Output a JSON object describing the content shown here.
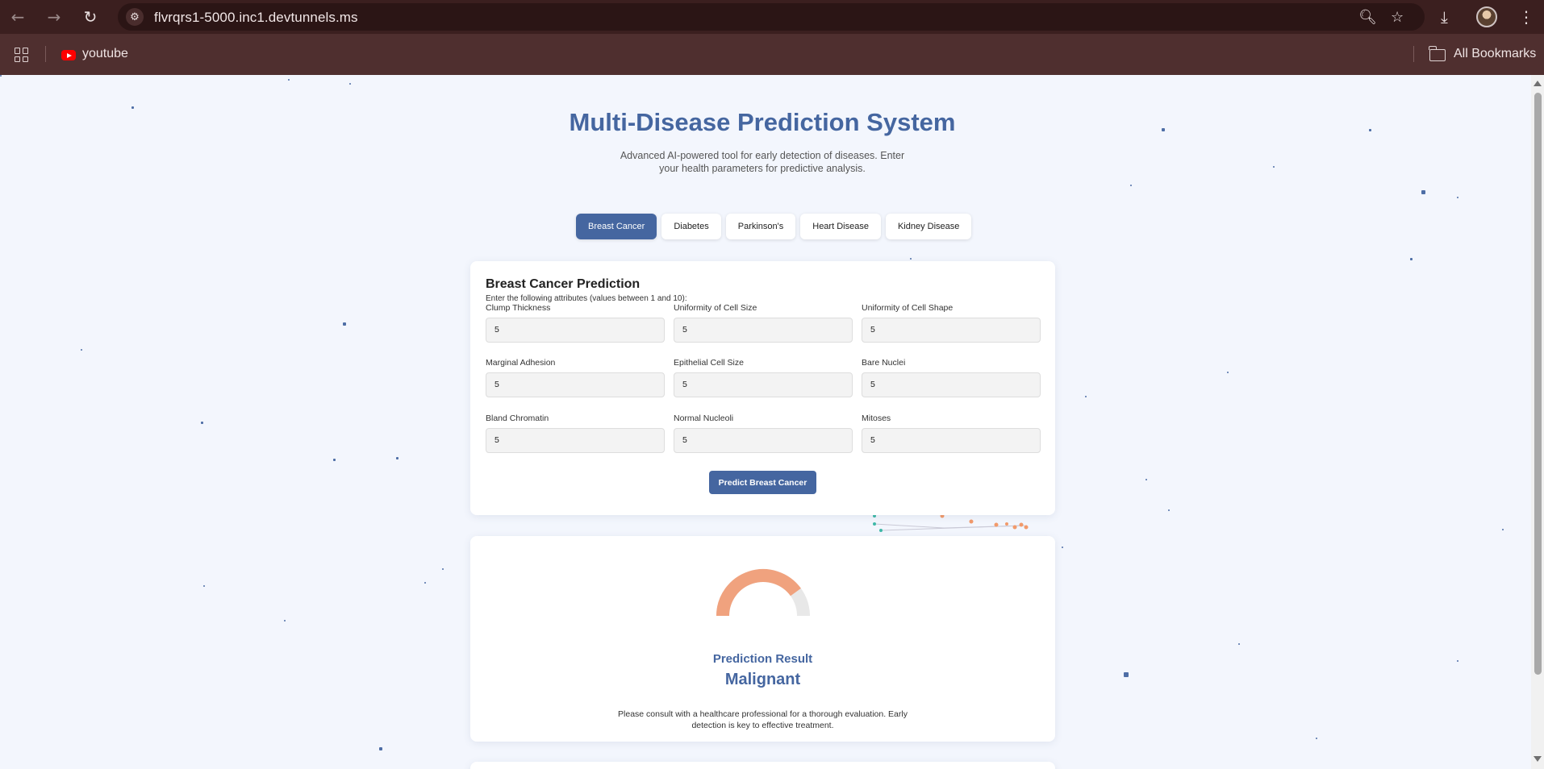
{
  "browser": {
    "url": "flvrqrs1-5000.inc1.devtunnels.ms",
    "bookmarks": [
      "youtube"
    ],
    "all_bookmarks_label": "All Bookmarks"
  },
  "page": {
    "title": "Multi-Disease Prediction System",
    "subtitle": "Advanced AI-powered tool for early detection of diseases. Enter your health parameters for predictive analysis.",
    "tabs": [
      {
        "label": "Breast Cancer",
        "active": true
      },
      {
        "label": "Diabetes",
        "active": false
      },
      {
        "label": "Parkinson's",
        "active": false
      },
      {
        "label": "Heart Disease",
        "active": false
      },
      {
        "label": "Kidney Disease",
        "active": false
      }
    ],
    "form": {
      "title": "Breast Cancer Prediction",
      "hint": "Enter the following attributes (values between 1 and 10):",
      "fields": [
        {
          "label": "Clump Thickness",
          "value": "5"
        },
        {
          "label": "Uniformity of Cell Size",
          "value": "5"
        },
        {
          "label": "Uniformity of Cell Shape",
          "value": "5"
        },
        {
          "label": "Marginal Adhesion",
          "value": "5"
        },
        {
          "label": "Epithelial Cell Size",
          "value": "5"
        },
        {
          "label": "Bare Nuclei",
          "value": "5"
        },
        {
          "label": "Bland Chromatin",
          "value": "5"
        },
        {
          "label": "Normal Nucleoli",
          "value": "5"
        },
        {
          "label": "Mitoses",
          "value": "5"
        }
      ],
      "submit_label": "Predict Breast Cancer"
    },
    "result": {
      "heading": "Prediction Result",
      "value": "Malignant",
      "note": "Please consult with a healthcare professional for a thorough evaluation. Early detection is key to effective treatment.",
      "gauge_fill_fraction": 0.8,
      "gauge_color": "#f0a27e"
    }
  },
  "colors": {
    "accent": "#4566a0",
    "page_bg": "#f3f6fd",
    "chrome_top": "#3b1f1f",
    "chrome_bookmarks": "#4f2f2f"
  }
}
